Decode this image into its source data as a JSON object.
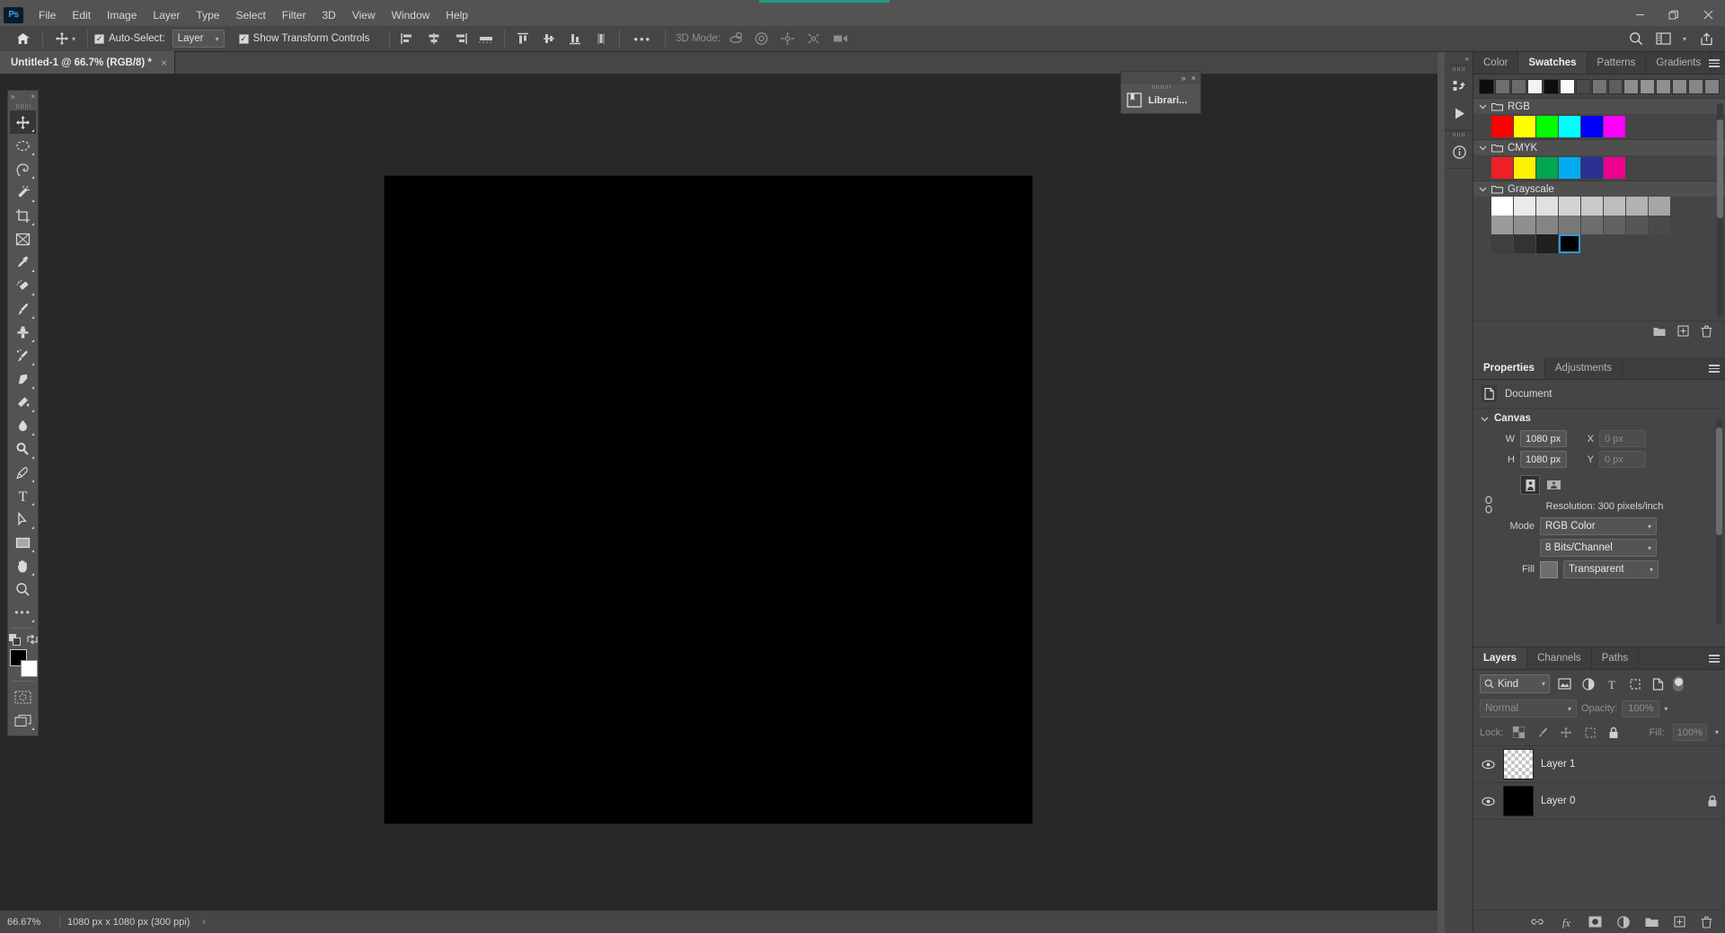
{
  "app": {
    "logo": "Ps",
    "menus": [
      "File",
      "Edit",
      "Image",
      "Layer",
      "Type",
      "Select",
      "Filter",
      "3D",
      "View",
      "Window",
      "Help"
    ],
    "window_controls": [
      "minimize",
      "restore",
      "close"
    ]
  },
  "options_bar": {
    "home_icon": "home-icon",
    "tool_icon": "move-tool-icon",
    "auto_select_label": "Auto-Select:",
    "auto_select_checked": true,
    "auto_select_value": "Layer",
    "show_transform_label": "Show Transform Controls",
    "show_transform_checked": true,
    "align_icons": [
      "align-left-edges",
      "align-horizontal-centers",
      "align-right-edges",
      "distribute-horizontally"
    ],
    "align_icons2": [
      "align-top-edges",
      "align-vertical-centers",
      "align-bottom-edges",
      "distribute-vertically"
    ],
    "more_label": "•••",
    "mode3d_label": "3D Mode:",
    "mode3d_icons": [
      "orbit-3d-icon",
      "roll-3d-icon",
      "pan-3d-icon",
      "slide-3d-icon",
      "zoom-3d-camera-icon"
    ],
    "right_icons": [
      "search-icon",
      "workspace-icon",
      "chevron-down-icon",
      "share-icon"
    ]
  },
  "document": {
    "tab_title": "Untitled-1 @ 66.7% (RGB/8) *",
    "close_glyph": "×",
    "canvas_color": "#000000"
  },
  "toolbar": {
    "collapse_glyph": "»",
    "close_glyph": "×",
    "tools": [
      {
        "name": "move-tool",
        "active": true,
        "corner": true
      },
      {
        "name": "marquee-tool",
        "active": false,
        "corner": true
      },
      {
        "name": "lasso-tool",
        "active": false,
        "corner": true
      },
      {
        "name": "magic-wand-tool",
        "active": false,
        "corner": true
      },
      {
        "name": "crop-tool",
        "active": false,
        "corner": true
      },
      {
        "name": "frame-tool",
        "active": false,
        "corner": false
      },
      {
        "name": "eyedropper-tool",
        "active": false,
        "corner": true
      },
      {
        "name": "healing-brush-tool",
        "active": false,
        "corner": true
      },
      {
        "name": "brush-tool",
        "active": false,
        "corner": true
      },
      {
        "name": "clone-stamp-tool",
        "active": false,
        "corner": true
      },
      {
        "name": "history-brush-tool",
        "active": false,
        "corner": true
      },
      {
        "name": "eraser-tool",
        "active": false,
        "corner": true
      },
      {
        "name": "gradient-tool",
        "active": false,
        "corner": true
      },
      {
        "name": "blur-tool",
        "active": false,
        "corner": true
      },
      {
        "name": "dodge-tool",
        "active": false,
        "corner": true
      },
      {
        "name": "pen-tool",
        "active": false,
        "corner": true
      },
      {
        "name": "type-tool",
        "active": false,
        "corner": true
      },
      {
        "name": "path-selection-tool",
        "active": false,
        "corner": true
      },
      {
        "name": "rectangle-shape-tool",
        "active": false,
        "corner": true
      },
      {
        "name": "hand-tool",
        "active": false,
        "corner": true
      },
      {
        "name": "zoom-tool",
        "active": false,
        "corner": false
      },
      {
        "name": "edit-toolbar-tool",
        "active": false,
        "corner": true
      }
    ],
    "foreground_color": "#000000",
    "background_color": "#ffffff",
    "quick_mask_icon": "quick-mask-icon",
    "screen_mode_icon": "screen-mode-icon"
  },
  "libraries_panel": {
    "collapse_glyph": "»",
    "close_glyph": "×",
    "label": "Librari...",
    "icon": "libraries-icon"
  },
  "mini_dock": {
    "collapse_glyph": "«",
    "buttons": [
      "history-icon",
      "actions-play-icon",
      "info-icon"
    ]
  },
  "swatches_panel": {
    "tabs": [
      {
        "label": "Color",
        "active": false
      },
      {
        "label": "Swatches",
        "active": true
      },
      {
        "label": "Patterns",
        "active": false
      },
      {
        "label": "Gradients",
        "active": false
      }
    ],
    "menu_icon": "panel-menu-icon",
    "recent": [
      "#0d0d0d",
      "#6e6e6e",
      "#6a6a6a",
      "#f2f2f2",
      "#0d0d0d",
      "#fbfbfb",
      "#4a4a4a",
      "#747474",
      "#5d5d5d",
      "#8d8d8d",
      "#949494",
      "#8f8f8f",
      "#8b8b8b",
      "#868686",
      "#838383"
    ],
    "groups": [
      {
        "name": "RGB",
        "folder_icon": "folder-icon",
        "chevron": "chevron-down-icon",
        "colors": [
          "#ff0000",
          "#ffff00",
          "#00ff00",
          "#00ffff",
          "#0000ff",
          "#ff00ff"
        ]
      },
      {
        "name": "CMYK",
        "folder_icon": "folder-icon",
        "chevron": "chevron-down-icon",
        "colors": [
          "#ed2024",
          "#fff200",
          "#00a650",
          "#00aeef",
          "#2b3192",
          "#ec008c"
        ]
      },
      {
        "name": "Grayscale",
        "folder_icon": "folder-icon",
        "chevron": "chevron-down-icon",
        "rows": [
          [
            "#ffffff",
            "#ebebeb",
            "#e0e0e0",
            "#d4d4d4",
            "#c9c9c9",
            "#bdbdbd",
            "#b2b2b2",
            "#a6a6a6"
          ],
          [
            "#9b9b9b",
            "#8f8f8f",
            "#848484",
            "#787878",
            "#6d6d6d",
            "#616161",
            "#565656",
            "#4a4a4a"
          ],
          [
            "#3f3f3f",
            "#333333",
            "#1f1f1f",
            "#000000"
          ]
        ],
        "selected_index": [
          2,
          3
        ]
      }
    ],
    "footer_icons": [
      "new-group-icon",
      "new-swatch-icon",
      "delete-swatch-icon"
    ]
  },
  "properties_panel": {
    "tabs": [
      {
        "label": "Properties",
        "active": true
      },
      {
        "label": "Adjustments",
        "active": false
      }
    ],
    "menu_icon": "panel-menu-icon",
    "doc_icon": "document-icon",
    "doc_label": "Document",
    "section_title": "Canvas",
    "section_chevron": "chevron-down-icon",
    "link_icon": "link-constrain-icon",
    "width_label": "W",
    "width_value": "1080 px",
    "height_label": "H",
    "height_value": "1080 px",
    "x_label": "X",
    "x_value": "0 px",
    "y_label": "Y",
    "y_value": "0 px",
    "orientation_portrait": "portrait-icon",
    "orientation_landscape": "landscape-icon",
    "resolution_text": "Resolution: 300 pixels/inch",
    "mode_label": "Mode",
    "mode_value": "RGB Color",
    "depth_value": "8 Bits/Channel",
    "fill_label": "Fill",
    "fill_value": "Transparent",
    "fill_swatch": "#6e6e6e"
  },
  "layers_panel": {
    "tabs": [
      {
        "label": "Layers",
        "active": true
      },
      {
        "label": "Channels",
        "active": false
      },
      {
        "label": "Paths",
        "active": false
      }
    ],
    "menu_icon": "panel-menu-icon",
    "filter_label": "Kind",
    "filter_search_icon": "search-icon",
    "filter_icons": [
      "pixel-filter-icon",
      "adjustment-filter-icon",
      "type-filter-icon",
      "shape-filter-icon",
      "smart-object-filter-icon"
    ],
    "filter_toggle": "filter-enable-toggle",
    "blend_mode": "Normal",
    "opacity_label": "Opacity:",
    "opacity_value": "100%",
    "lock_label": "Lock:",
    "lock_icons": [
      "lock-transparency-icon",
      "lock-image-icon",
      "lock-position-icon",
      "lock-artboard-icon",
      "lock-all-icon"
    ],
    "fill_label": "Fill:",
    "fill_value": "100%",
    "layers": [
      {
        "name": "Layer 1",
        "visible": true,
        "thumb": "checker",
        "locked": false,
        "selected": false
      },
      {
        "name": "Layer 0",
        "visible": true,
        "thumb": "black",
        "locked": true,
        "selected": false
      }
    ],
    "footer_icons": [
      "link-layers-icon",
      "layer-style-fx-icon",
      "add-mask-icon",
      "adjustment-layer-icon",
      "new-group-icon",
      "new-layer-icon",
      "delete-layer-icon"
    ]
  },
  "status_bar": {
    "zoom": "66.67%",
    "doc_info": "1080 px x 1080 px (300 ppi)",
    "arrow": "›"
  }
}
